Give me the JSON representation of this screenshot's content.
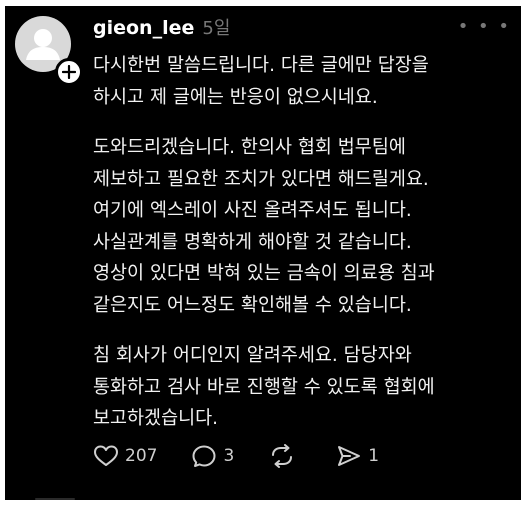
{
  "post": {
    "username": "gieon_lee",
    "time": "5일",
    "more_icon": "more-horizontal-icon",
    "paragraphs": [
      [
        "다시한번 말씀드립니다. 다른 글에만 답장을",
        "하시고 제 글에는 반응이 없으시네요."
      ],
      [
        "도와드리겠습니다. 한의사 협회 법무팀에",
        "제보하고 필요한 조치가 있다면 해드릴게요.",
        "여기에 엑스레이 사진 올려주셔도 됩니다.",
        "사실관계를 명확하게 해야할 것 같습니다.",
        "영상이 있다면 박혀 있는 금속이 의료용 침과",
        "같은지도 어느정도 확인해볼 수 있습니다."
      ],
      [
        "침 회사가 어디인지 알려주세요. 담당자와",
        "통화하고 검사 바로 진행할 수 있도록 협회에",
        "보고하겠습니다."
      ]
    ]
  },
  "actions": {
    "likes": "207",
    "replies": "3",
    "reposts": "",
    "shares": "1"
  },
  "colors": {
    "background": "#000000",
    "text": "#f2f2f2",
    "muted": "#777777"
  }
}
